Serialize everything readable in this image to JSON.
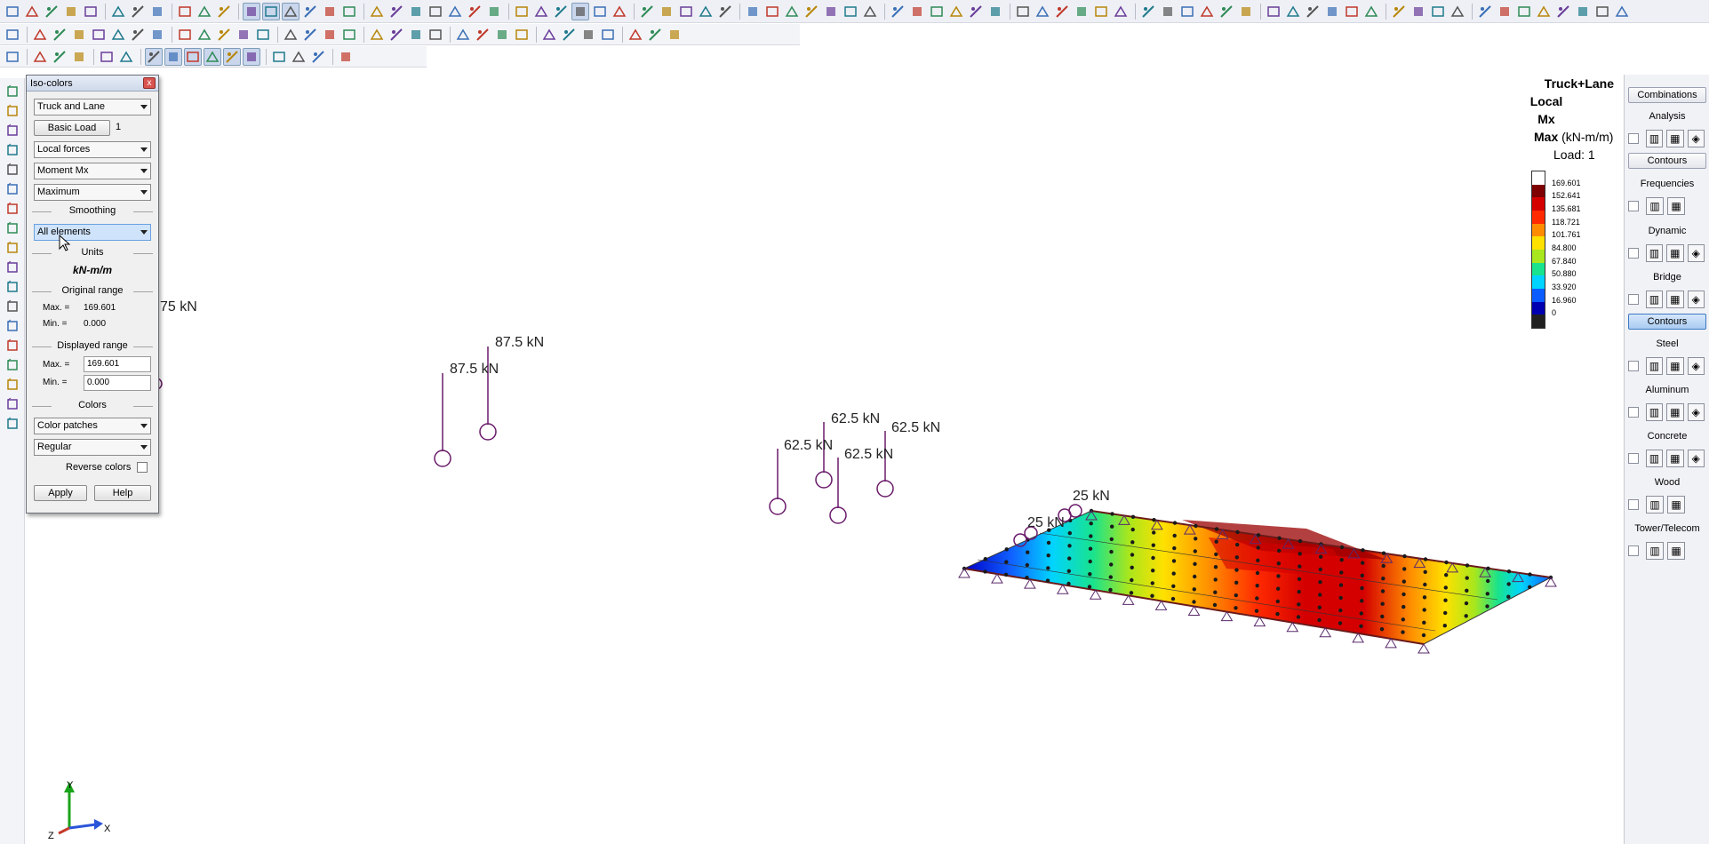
{
  "dialog": {
    "title": "Iso-colors",
    "close": "x",
    "load_case": "Truck and Lane",
    "basic_load_button": "Basic Load",
    "basic_load_value": "1",
    "force_type": "Local forces",
    "component": "Moment Mx",
    "extreme": "Maximum",
    "smoothing_label": "Smoothing",
    "smoothing_value": "All elements",
    "units_label": "Units",
    "units_value": "kN-m/m",
    "original_range_label": "Original range",
    "orig_max_label": "Max. =",
    "orig_max": "169.601",
    "orig_min_label": "Min. =",
    "orig_min": "0.000",
    "displayed_range_label": "Displayed range",
    "disp_max_label": "Max. =",
    "disp_max": "169.601",
    "disp_min_label": "Min. =",
    "disp_min": "0.000",
    "colors_label": "Colors",
    "color_mode": "Color patches",
    "color_scheme": "Regular",
    "reverse_label": "Reverse colors",
    "apply_button": "Apply",
    "help_button": "Help"
  },
  "legend": {
    "line1": "Truck+Lane",
    "line2": "Local",
    "line3": "Mx",
    "line4_bold": "Max",
    "line4_units": "(kN-m/m)",
    "line5": "Load: 1",
    "values": [
      "169.601",
      "152.641",
      "135.681",
      "118.721",
      "101.761",
      "84.800",
      "67.840",
      "50.880",
      "33.920",
      "16.960",
      "0"
    ],
    "colors": [
      "#ffffff",
      "#7f0000",
      "#d40000",
      "#ff2a00",
      "#ff8c00",
      "#ffe100",
      "#a8e61d",
      "#19e38c",
      "#00d4ff",
      "#0a5cff",
      "#0000b0",
      "#202020"
    ]
  },
  "loads": {
    "l1": "75 kN",
    "l2": "87.5 kN",
    "l3": "87.5 kN",
    "l4": "62.5 kN",
    "l5": "62.5 kN",
    "l6": "62.5 kN",
    "l7": "62.5 kN",
    "l8": "25 kN",
    "l9": "25 kN"
  },
  "axes": {
    "x": "X",
    "y": "Y",
    "z": "Z"
  },
  "right_panel": {
    "combinations": "Combinations",
    "analysis": "Analysis",
    "contours1": "Contours",
    "frequencies": "Frequencies",
    "dynamic": "Dynamic",
    "bridge": "Bridge",
    "contours2": "Contours",
    "steel": "Steel",
    "aluminum": "Aluminum",
    "concrete": "Concrete",
    "wood": "Wood",
    "tower": "Tower/Telecom"
  }
}
